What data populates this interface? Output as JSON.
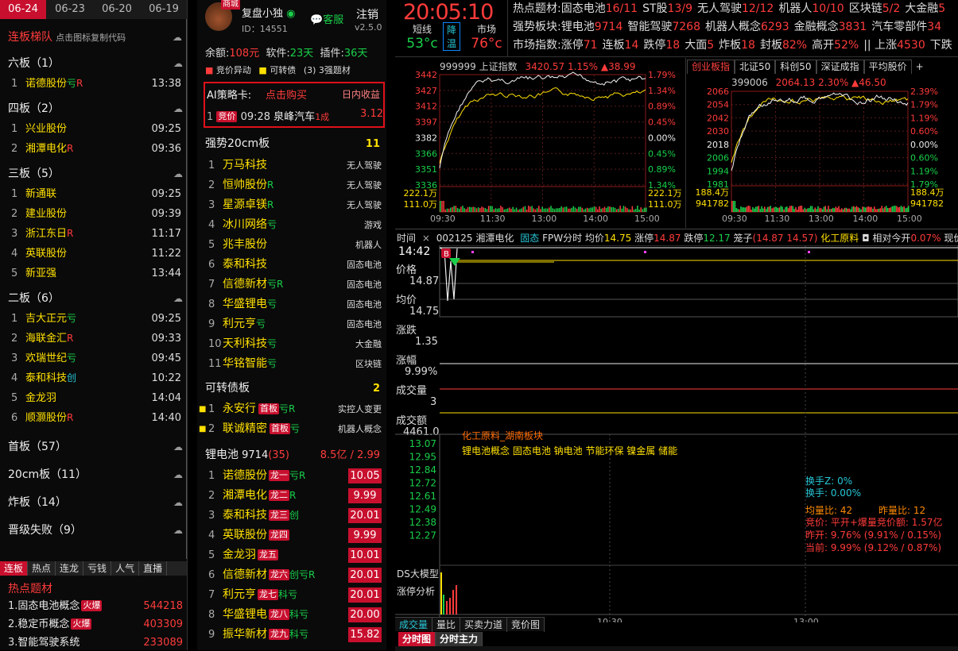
{
  "date_tabs": [
    "06-24",
    "06-23",
    "06-20",
    "06-19"
  ],
  "ladder": {
    "title": "连板梯队",
    "hint": "点击图标复制代码",
    "groups": [
      {
        "label": "六板（1）",
        "items": [
          {
            "n": "1",
            "name": "诺德股份",
            "f1": "亏",
            "f2": "R",
            "time": "13:38"
          }
        ]
      },
      {
        "label": "四板（2）",
        "items": [
          {
            "n": "1",
            "name": "兴业股份",
            "f1": "",
            "f2": "",
            "time": "09:25"
          },
          {
            "n": "2",
            "name": "湘潭电化",
            "f1": "",
            "f2": "R",
            "time": "09:36"
          }
        ]
      },
      {
        "label": "三板（5）",
        "items": [
          {
            "n": "1",
            "name": "新通联",
            "f1": "",
            "f2": "",
            "time": "09:25"
          },
          {
            "n": "2",
            "name": "建业股份",
            "f1": "",
            "f2": "",
            "time": "09:39"
          },
          {
            "n": "3",
            "name": "浙江东日",
            "f1": "",
            "f2": "R",
            "time": "11:17"
          },
          {
            "n": "4",
            "name": "英联股份",
            "f1": "",
            "f2": "",
            "time": "11:22"
          },
          {
            "n": "5",
            "name": "新亚强",
            "f1": "",
            "f2": "",
            "time": "13:44"
          }
        ]
      },
      {
        "label": "二板（6）",
        "items": [
          {
            "n": "1",
            "name": "吉大正元",
            "f1": "亏",
            "f2": "",
            "time": "09:25"
          },
          {
            "n": "2",
            "name": "海联金汇",
            "f1": "",
            "f2": "R",
            "time": "09:33"
          },
          {
            "n": "3",
            "name": "欢瑞世纪",
            "f1": "亏",
            "f2": "",
            "time": "09:45"
          },
          {
            "n": "4",
            "name": "泰和科技",
            "f1": "创",
            "f2": "",
            "time": "10:22"
          },
          {
            "n": "5",
            "name": "金龙羽",
            "f1": "",
            "f2": "",
            "time": "14:04"
          },
          {
            "n": "6",
            "name": "顺灏股份",
            "f1": "",
            "f2": "R",
            "time": "14:40"
          }
        ]
      }
    ],
    "collapsed": [
      "首板（57）",
      "20cm板（11）",
      "炸板（14）",
      "晋级失败（9）"
    ],
    "bottom_tabs": [
      "连板",
      "热点",
      "连龙",
      "亏钱",
      "人气",
      "直播"
    ],
    "hot_title": "热点题材",
    "hot": [
      {
        "n": "1.",
        "name": "固态电池概念",
        "tag": "火爆",
        "val": "544218"
      },
      {
        "n": "2.",
        "name": "稳定币概念",
        "tag": "火爆",
        "val": "403309"
      },
      {
        "n": "3.",
        "name": "智能驾驶系统",
        "tag": "",
        "val": "233089"
      }
    ]
  },
  "user": {
    "badge": "商城",
    "name": "复盘小独",
    "id": "ID：14551",
    "service": "客服",
    "logout": "注销",
    "version": "v2.5.0",
    "balance_label": "余额:",
    "balance": "108元",
    "soft_label": "软件:",
    "soft": "23天",
    "plugin_label": "插件:",
    "plugin": "36天",
    "opt1": "竞价异动",
    "opt2": "可转债",
    "opt3": "(3) 3强题材"
  },
  "ai_card": {
    "title": "AI策略卡:",
    "buy": "点击购买",
    "income": "日内收益",
    "row": {
      "n": "1",
      "tag": "竞价",
      "time": "09:28",
      "name": "泉峰汽车",
      "f": "1成",
      "val": "3.12"
    }
  },
  "strong20": {
    "title": "强势20cm板",
    "count": "11",
    "items": [
      {
        "n": "1",
        "name": "万马科技",
        "f": "",
        "cat": "无人驾驶"
      },
      {
        "n": "2",
        "name": "恒帅股份",
        "f": "R",
        "cat": "无人驾驶"
      },
      {
        "n": "3",
        "name": "星源卓镁",
        "f": "R",
        "cat": "无人驾驶"
      },
      {
        "n": "4",
        "name": "冰川网络",
        "f": "亏",
        "cat": "游戏"
      },
      {
        "n": "5",
        "name": "兆丰股份",
        "f": "",
        "cat": "机器人"
      },
      {
        "n": "6",
        "name": "泰和科技",
        "f": "",
        "cat": "固态电池"
      },
      {
        "n": "7",
        "name": "信德新材",
        "f": "亏R",
        "cat": "固态电池"
      },
      {
        "n": "8",
        "name": "华盛锂电",
        "f": "亏",
        "cat": "固态电池"
      },
      {
        "n": "9",
        "name": "利元亨",
        "f": "亏",
        "cat": "固态电池"
      },
      {
        "n": "10",
        "name": "天利科技",
        "f": "亏",
        "cat": "大金融"
      },
      {
        "n": "11",
        "name": "华铭智能",
        "f": "亏",
        "cat": "区块链"
      }
    ]
  },
  "bonds": {
    "title": "可转债板",
    "count": "2",
    "items": [
      {
        "n": "1",
        "name": "永安行",
        "tag": "首板",
        "f": "亏R",
        "cat": "实控人变更"
      },
      {
        "n": "2",
        "name": "联诚精密",
        "tag": "首板",
        "f": "亏",
        "cat": "机器人概念"
      }
    ]
  },
  "lithium": {
    "title": "锂电池",
    "code": "9714",
    "cnt": "(35)",
    "amt": "8.5亿 / 2.99",
    "items": [
      {
        "n": "1",
        "name": "诺德股份",
        "tag": "龙一",
        "f": "亏R",
        "val": "10.05"
      },
      {
        "n": "2",
        "name": "湘潭电化",
        "tag": "龙二",
        "f": "R",
        "val": "9.99"
      },
      {
        "n": "3",
        "name": "泰和科技",
        "tag": "龙三",
        "f": "创",
        "val": "20.01"
      },
      {
        "n": "4",
        "name": "英联股份",
        "tag": "龙四",
        "f": "",
        "val": "9.99"
      },
      {
        "n": "5",
        "name": "金龙羽",
        "tag": "龙五",
        "f": "",
        "val": "10.01"
      },
      {
        "n": "6",
        "name": "信德新材",
        "tag": "龙六",
        "f": "创亏R",
        "val": "20.01"
      },
      {
        "n": "7",
        "name": "利元亨",
        "tag": "龙七",
        "f": "科亏",
        "val": "20.01"
      },
      {
        "n": "8",
        "name": "华盛锂电",
        "tag": "龙八",
        "f": "科亏",
        "val": "20.00"
      },
      {
        "n": "9",
        "name": "振华新材",
        "tag": "龙九",
        "f": "科亏",
        "val": "15.82"
      }
    ]
  },
  "clock": {
    "time": "20:05:10",
    "l1a": "短线",
    "l1b": "53°c",
    "l2a": "降",
    "l2b": "温",
    "l3a": "市场",
    "l3b": "76°c"
  },
  "ticker": {
    "r1_label": "热点题材:",
    "r1": [
      {
        "n": "固态电池",
        "v": "16/11"
      },
      {
        "n": "ST股",
        "v": "13/9"
      },
      {
        "n": "无人驾驶",
        "v": "12/12"
      },
      {
        "n": "机器人",
        "v": "10/10"
      },
      {
        "n": "区块链",
        "v": "5/2"
      },
      {
        "n": "大金融",
        "v": "5"
      }
    ],
    "r2_label": "强势板块:",
    "r2": [
      {
        "n": "锂电池",
        "v": "9714"
      },
      {
        "n": "智能驾驶",
        "v": "7268"
      },
      {
        "n": "机器人概念",
        "v": "6293"
      },
      {
        "n": "金融概念",
        "v": "3831"
      },
      {
        "n": "汽车零部件",
        "v": "34"
      }
    ],
    "r3_label": "市场指数:",
    "r3": [
      {
        "n": "涨停",
        "v": "71"
      },
      {
        "n": "连板",
        "v": "14"
      },
      {
        "n": "跌停",
        "v": "18"
      },
      {
        "n": "大面",
        "v": "5"
      },
      {
        "n": "炸板",
        "v": "18"
      },
      {
        "n": "封板",
        "v": "82%"
      },
      {
        "n": "高开",
        "v": "52%"
      },
      {
        "n": "|| 上涨",
        "v": "4530"
      },
      {
        "n": "下跌",
        "v": ""
      }
    ]
  },
  "sh": {
    "code": "999999",
    "name": "上证指数",
    "price": "3420.57",
    "pct": "1.15%",
    "chg": "▲38.99",
    "yl": [
      "3442",
      "3427",
      "3412",
      "3397",
      "3382",
      "3366",
      "3351",
      "3336"
    ],
    "yr": [
      "1.79%",
      "1.34%",
      "0.89%",
      "0.45%",
      "0.00%",
      "0.45%",
      "0.89%",
      "1.34%"
    ],
    "vol": [
      "222.1万",
      "111.0万"
    ],
    "vr": [
      "222.1万",
      "111.0万"
    ],
    "xt": [
      "09:30",
      "11:30",
      "13:00",
      "14:00",
      "15:00"
    ]
  },
  "cy": {
    "tabs": [
      "创业板指",
      "北证50",
      "科创50",
      "深证成指",
      "平均股价"
    ],
    "code": "399006",
    "price": "2064.13",
    "pct": "2.30%",
    "chg": "▲46.50",
    "yl": [
      "2066",
      "2054",
      "2042",
      "2030",
      "2018",
      "2006",
      "1994",
      "1981"
    ],
    "yr": [
      "2.39%",
      "1.79%",
      "1.19%",
      "0.60%",
      "0.00%",
      "0.60%",
      "1.19%",
      "1.79%"
    ],
    "vol": [
      "188.4万",
      "941782"
    ],
    "vr": [
      "188.4万",
      "941782"
    ],
    "xt": [
      "09:30",
      "11:30",
      "13:00",
      "14:00",
      "15:00"
    ]
  },
  "stock": {
    "time_label": "时间",
    "code": "002125",
    "name": "湘潭电化",
    "fixed": "固态",
    "fpw": "FPW分时",
    "avg_l": "均价",
    "avg": "14.75",
    "up_l": "涨停",
    "up": "14.87",
    "dn_l": "跌停",
    "dn": "12.17",
    "cage": "笼子",
    "cage_v": "(14.87 14.57)",
    "sector": "化工原料",
    "rel": "相对今开",
    "rel_v": "0.07%",
    "now": "现价",
    "side_time": "14:42",
    "price_l": "价格",
    "price": "14.87",
    "avgp_l": "均价",
    "avgp": "14.75",
    "chg_l": "涨跌",
    "chg": "1.35",
    "rng_l": "涨幅",
    "rng": "9.99%",
    "vol_l": "成交量",
    "vol": "3",
    "amt_l": "成交额",
    "amt": "4461.0",
    "yl": [
      "13.07",
      "12.95",
      "12.84",
      "12.72",
      "12.61",
      "12.49",
      "12.38",
      "12.27"
    ],
    "sector_line": "化工原料_湖南板块",
    "concepts": "锂电池概念 固态电池 钠电池 节能环保 镍金属 储能",
    "stats": {
      "a": "换手Z: 0%",
      "b": "换手: 0.00%",
      "c": "均量比: 42",
      "d": "昨量比: 12",
      "e": "竞价: 平开+爆量竞价额: 1.57亿",
      "f": "昨开: 9.76% (9.91% / 0.15%)",
      "g": "当前: 9.99% (9.12% / 0.87%)"
    },
    "ds1": "DS大模型",
    "ds2": "涨停分析",
    "xt": [
      "10:30",
      "13:00"
    ],
    "tabs1": [
      "成交量",
      "量比",
      "买卖力道",
      "竞价图"
    ],
    "tabs2": [
      "分时图",
      "分时主力"
    ]
  }
}
